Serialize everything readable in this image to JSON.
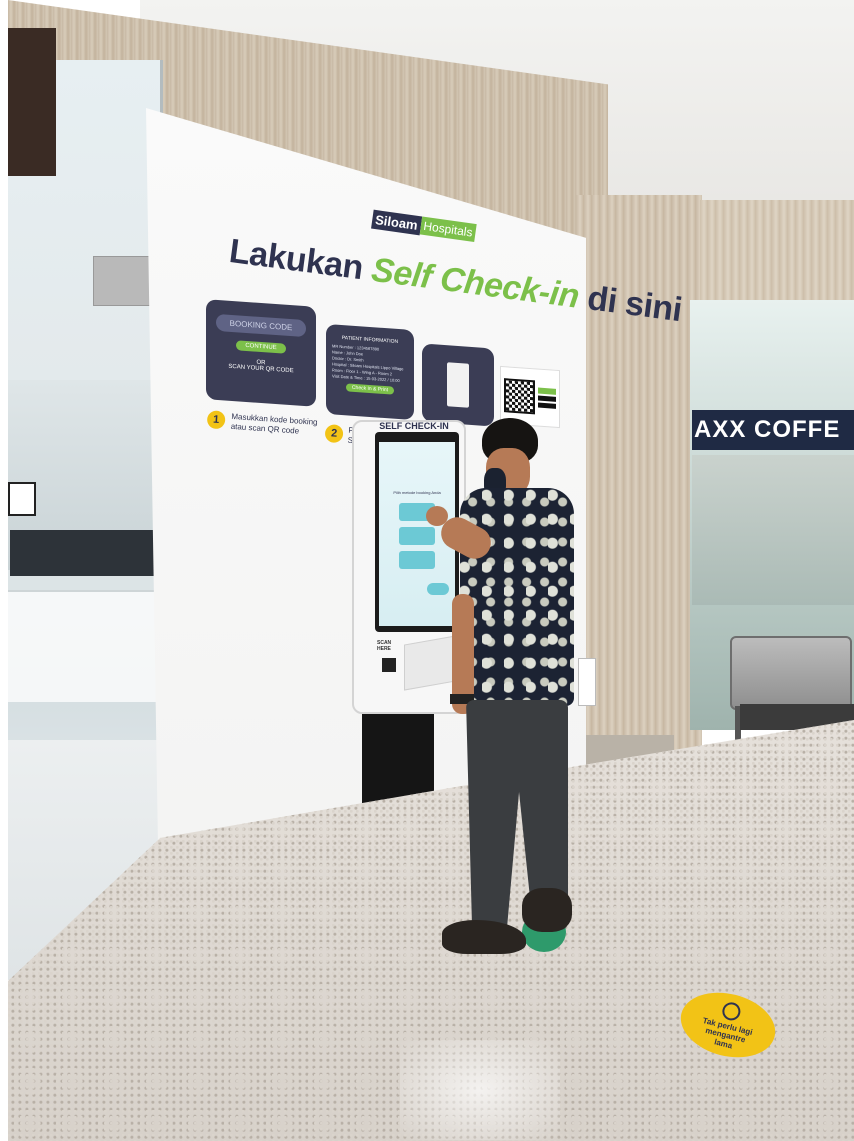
{
  "brand": {
    "name_part1": "Siloam",
    "name_part2": "Hospitals"
  },
  "sign": {
    "title_part1": "Lakukan ",
    "title_accent": "Self Check-in",
    "title_part2": " di sini",
    "card1": {
      "heading": "BOOKING CODE",
      "button": "CONTINUE",
      "or": "OR",
      "scan": "SCAN YOUR QR CODE"
    },
    "card2": {
      "heading": "PATIENT INFORMATION",
      "rows": [
        "MR Number : 1234567890",
        "Name : John Doe",
        "Doctor : Dr. Smith",
        "Hospital : Siloam Hospitals Lippo Village",
        "Room : Floor 1 - Wing A - Room 2",
        "Visit Date & Time : 15-03-2022 / 10:00"
      ],
      "button": "Check In & Print"
    },
    "steps": [
      {
        "number": "1",
        "text_line1": "Masukkan kode booking",
        "text_line2": "atau scan QR code"
      },
      {
        "number": "2",
        "text_line1": "P",
        "text_line2": "S"
      }
    ]
  },
  "kiosk": {
    "header": "SELF CHECK-IN",
    "screen_prompt": "Pilih metode booking Anda",
    "scan_label_1": "SCAN",
    "scan_label_2": "HERE"
  },
  "storefront": {
    "cafe_sign": "AXX COFFE"
  },
  "floor_sticker": {
    "line1": "Tak perlu lagi",
    "line2": "mengantre",
    "line3": "lama"
  },
  "colors": {
    "sign_navy": "#2f3350",
    "brand_green": "#7cc04a",
    "card_bg": "#3b3d55",
    "cafe_sign_bg": "#1f2a44",
    "sticker_yellow": "#f2c316",
    "kiosk_screen": "#6cc9d5"
  },
  "icons": [
    "clock-icon",
    "qr-code-icon",
    "siloam-logo-icon"
  ]
}
